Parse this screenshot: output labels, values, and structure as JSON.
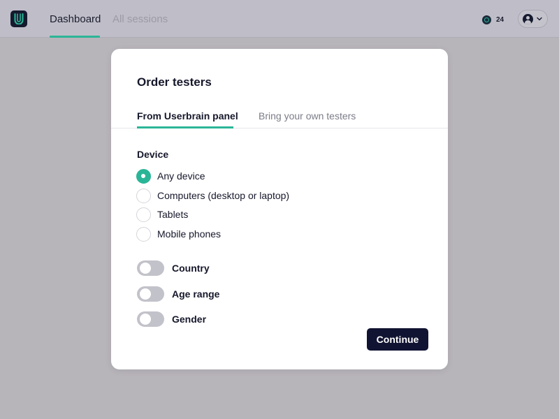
{
  "nav": {
    "tabs": [
      {
        "label": "Dashboard",
        "active": true
      },
      {
        "label": "All sessions",
        "active": false
      }
    ],
    "credits": "24",
    "logo_icon": "userbrain-logo-icon",
    "credits_icon": "credits-icon",
    "account_icon": "user-avatar-icon",
    "chevron_icon": "chevron-down-icon"
  },
  "modal": {
    "title": "Order testers",
    "tabs": [
      {
        "label": "From Userbrain panel",
        "active": true
      },
      {
        "label": "Bring your own testers",
        "active": false
      }
    ],
    "device": {
      "label": "Device",
      "options": [
        {
          "label": "Any device",
          "checked": true
        },
        {
          "label": "Computers (desktop or laptop)",
          "checked": false
        },
        {
          "label": "Tablets",
          "checked": false
        },
        {
          "label": "Mobile phones",
          "checked": false
        }
      ]
    },
    "toggles": [
      {
        "label": "Country",
        "on": false
      },
      {
        "label": "Age range",
        "on": false
      },
      {
        "label": "Gender",
        "on": false
      }
    ],
    "continue_label": "Continue"
  },
  "colors": {
    "accent": "#2bb597",
    "primary_button": "#101331",
    "backdrop": "#b7b4ba"
  }
}
